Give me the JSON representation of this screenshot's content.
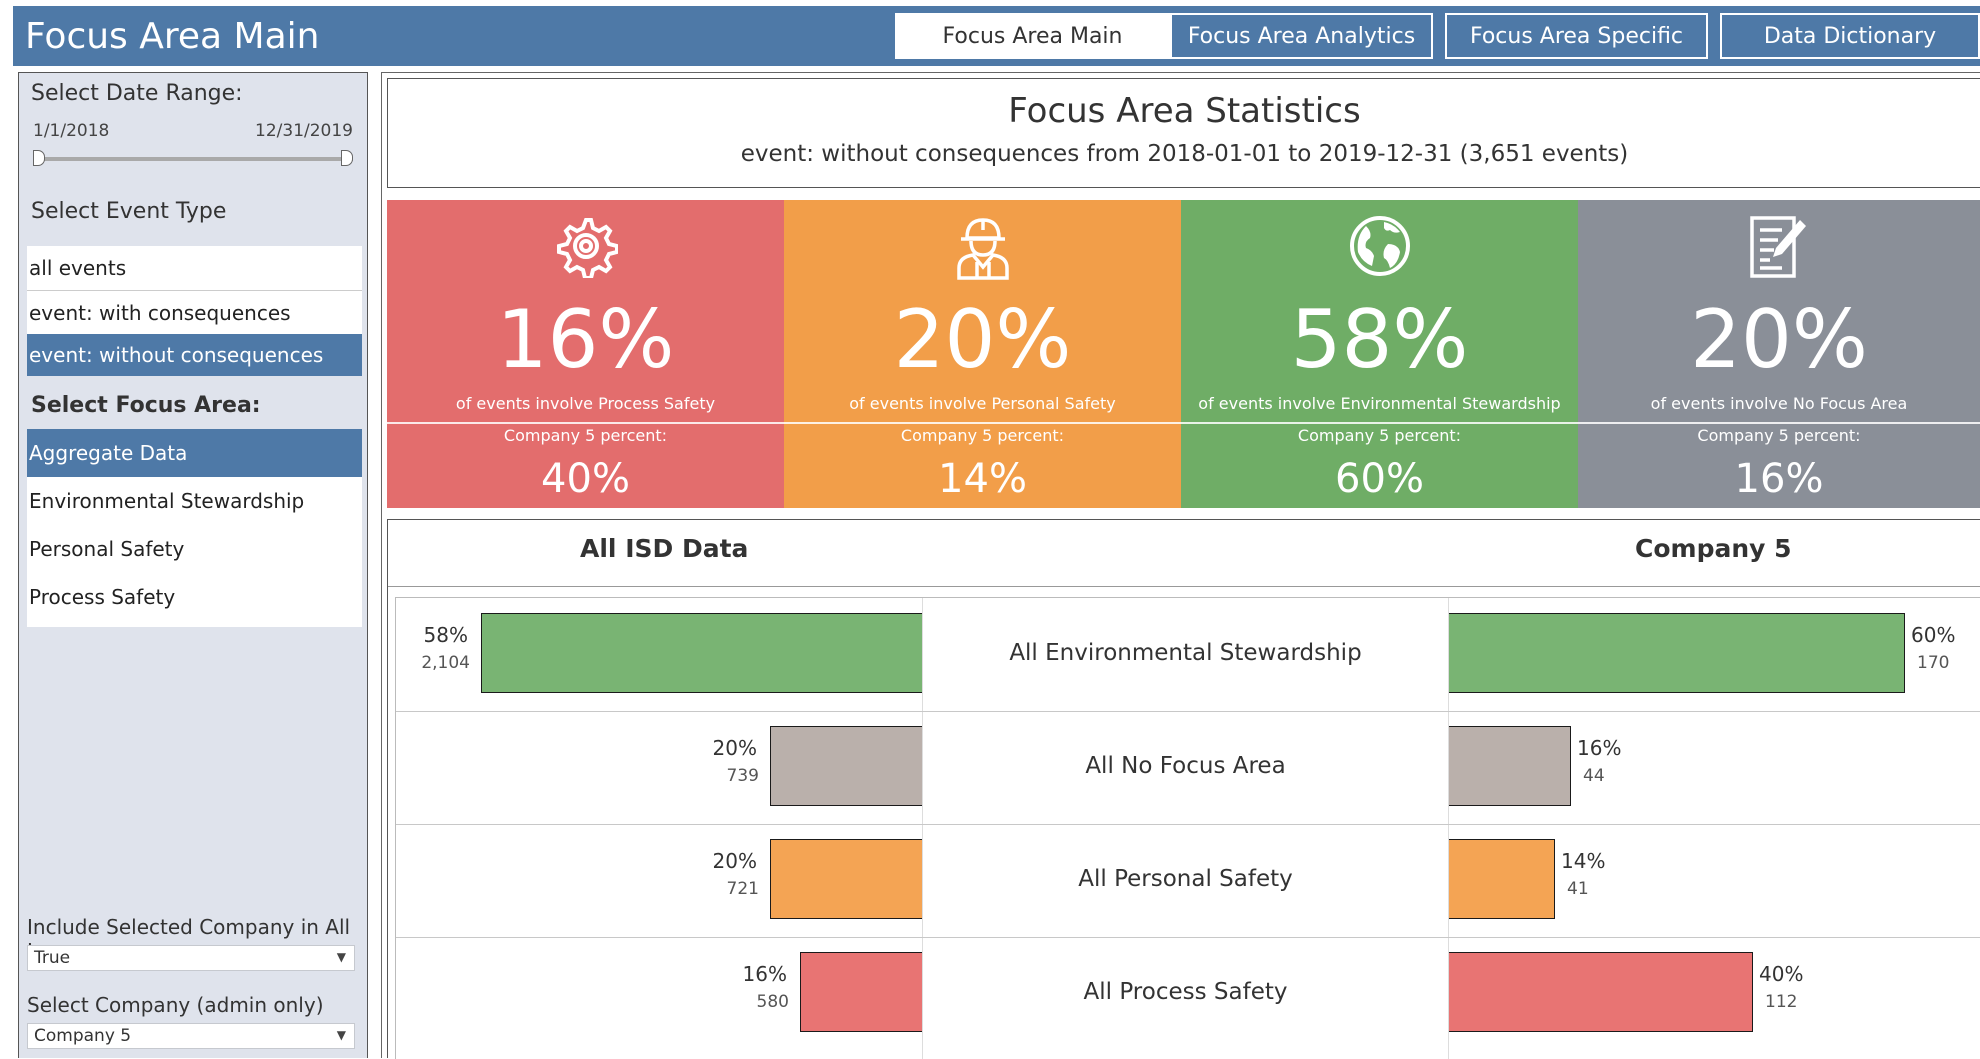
{
  "header": {
    "title": "Focus Area Main",
    "tabs": [
      {
        "label": "Focus Area Main",
        "active": true
      },
      {
        "label": "Focus Area Analytics",
        "active": false
      },
      {
        "label": "Focus Area Specific",
        "active": false
      },
      {
        "label": "Data Dictionary",
        "active": false
      }
    ]
  },
  "sidebar": {
    "date_range": {
      "heading": "Select Date Range:",
      "start": "1/1/2018",
      "end": "12/31/2019"
    },
    "event_type": {
      "heading": "Select Event Type",
      "options": [
        "all events",
        "event: with consequences",
        "event: without consequences"
      ],
      "selected_index": 2
    },
    "focus_area": {
      "heading": "Select Focus Area:",
      "options": [
        "Aggregate Data",
        "Environmental Stewardship",
        "Personal Safety",
        "Process Safety"
      ],
      "selected_index": 0
    },
    "include_company": {
      "label": "Include Selected Company in All I..",
      "value": "True"
    },
    "select_company": {
      "label": "Select Company (admin only)",
      "value": "Company 5"
    }
  },
  "stats": {
    "title": "Focus Area Statistics",
    "subtitle": "event: without consequences from 2018-01-01 to 2019-12-31 (3,651 events)"
  },
  "kpis": [
    {
      "icon": "gear-icon",
      "pct": "16%",
      "desc": "of events involve Process Safety",
      "company_label": "Company 5 percent:",
      "company_pct": "40%",
      "color": "#e36d6d"
    },
    {
      "icon": "worker-icon",
      "pct": "20%",
      "desc": "of events involve Personal Safety",
      "company_label": "Company 5 percent:",
      "company_pct": "14%",
      "color": "#f29e49"
    },
    {
      "icon": "globe-icon",
      "pct": "58%",
      "desc": "of events involve Environmental Stewardship",
      "company_label": "Company 5 percent:",
      "company_pct": "60%",
      "color": "#6fad66"
    },
    {
      "icon": "document-icon",
      "pct": "20%",
      "desc": "of events involve No Focus Area",
      "company_label": "Company 5 percent:",
      "company_pct": "16%",
      "color": "#8a8f98"
    }
  ],
  "comparison": {
    "left_heading": "All ISD Data",
    "right_heading": "Company 5",
    "rows": [
      {
        "label": "All Environmental Stewardship",
        "left_pct": "58%",
        "left_count": "2,104",
        "left_value": 0.58,
        "right_pct": "60%",
        "right_count": "170",
        "right_value": 0.6,
        "color": "#79b473"
      },
      {
        "label": "All No Focus Area",
        "left_pct": "20%",
        "left_count": "739",
        "left_value": 0.2,
        "right_pct": "16%",
        "right_count": "44",
        "right_value": 0.16,
        "color": "#bab0ab"
      },
      {
        "label": "All Personal Safety",
        "left_pct": "20%",
        "left_count": "721",
        "left_value": 0.2,
        "right_pct": "14%",
        "right_count": "41",
        "right_value": 0.14,
        "color": "#f4a454"
      },
      {
        "label": "All Process Safety",
        "left_pct": "16%",
        "left_count": "580",
        "left_value": 0.16,
        "right_pct": "40%",
        "right_count": "112",
        "right_value": 0.4,
        "color": "#e87473"
      }
    ]
  }
}
